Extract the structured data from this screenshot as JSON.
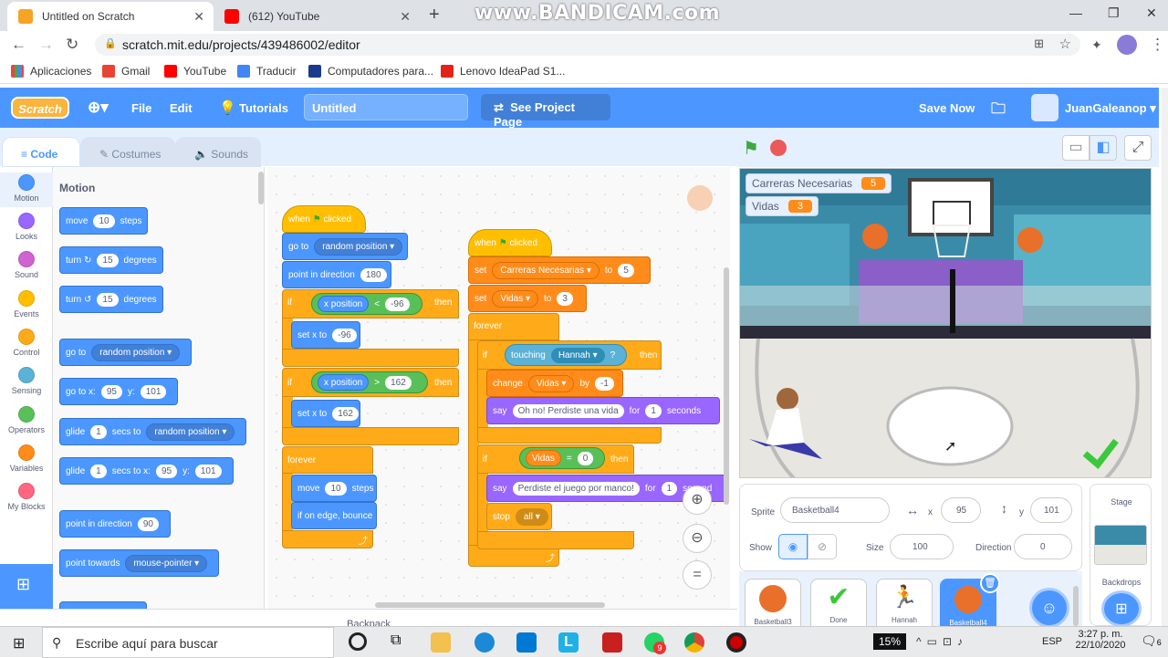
{
  "browser": {
    "tabs": [
      {
        "title": "Untitled on Scratch",
        "active": true
      },
      {
        "title": "(612) YouTube",
        "active": false
      }
    ],
    "watermark": "www.BANDICAM.com",
    "url": "scratch.mit.edu/projects/439486002/editor",
    "bookmarks": [
      "Aplicaciones",
      "Gmail",
      "YouTube",
      "Traducir",
      "Computadores para...",
      "Lenovo IdeaPad S1..."
    ]
  },
  "menu": {
    "logo": "Scratch",
    "file": "File",
    "edit": "Edit",
    "tutorials": "Tutorials",
    "project_title": "Untitled",
    "see_project": "See Project Page",
    "save": "Save Now",
    "user": "JuanGaleanop"
  },
  "editor_tabs": {
    "code": "Code",
    "costumes": "Costumes",
    "sounds": "Sounds"
  },
  "categories": [
    {
      "label": "Motion",
      "color": "#4c97ff"
    },
    {
      "label": "Looks",
      "color": "#9966ff"
    },
    {
      "label": "Sound",
      "color": "#cf63cf"
    },
    {
      "label": "Events",
      "color": "#ffbf00"
    },
    {
      "label": "Control",
      "color": "#ffab19"
    },
    {
      "label": "Sensing",
      "color": "#5cb1d6"
    },
    {
      "label": "Operators",
      "color": "#59c059"
    },
    {
      "label": "Variables",
      "color": "#ff8c1a"
    },
    {
      "label": "My Blocks",
      "color": "#ff6680"
    }
  ],
  "palette": {
    "heading": "Motion",
    "move": {
      "a": "move",
      "v": "10",
      "b": "steps"
    },
    "turn_r": {
      "a": "turn",
      "v": "15",
      "b": "degrees"
    },
    "turn_l": {
      "a": "turn",
      "v": "15",
      "b": "degrees"
    },
    "goto": {
      "a": "go to",
      "d": "random position"
    },
    "gotoxy": {
      "a": "go to x:",
      "x": "95",
      "y_label": "y:",
      "y": "101"
    },
    "glide": {
      "a": "glide",
      "v": "1",
      "b": "secs to",
      "d": "random position"
    },
    "glidexy": {
      "a": "glide",
      "v": "1",
      "b": "secs to x:",
      "x": "95",
      "y_label": "y:",
      "y": "101"
    },
    "point": {
      "a": "point in direction",
      "v": "90"
    },
    "towards": {
      "a": "point towards",
      "d": "mouse-pointer"
    }
  },
  "script1": {
    "hat": {
      "a": "when",
      "b": "clicked"
    },
    "goto": {
      "a": "go to",
      "d": "random position"
    },
    "point": {
      "a": "point in direction",
      "v": "180"
    },
    "if1": {
      "if": "if",
      "rep": "x position",
      "op": "<",
      "v": "-96",
      "then": "then"
    },
    "setx1": {
      "a": "set x to",
      "v": "-96"
    },
    "if2": {
      "if": "if",
      "rep": "x position",
      "op": ">",
      "v": "162",
      "then": "then"
    },
    "setx2": {
      "a": "set x to",
      "v": "162"
    },
    "forever": "forever",
    "move": {
      "a": "move",
      "v": "10",
      "b": "steps"
    },
    "bounce": "if on edge, bounce"
  },
  "script2": {
    "hat": {
      "a": "when",
      "b": "clicked"
    },
    "set1": {
      "a": "set",
      "d": "Carreras Necesarias",
      "b": "to",
      "v": "5"
    },
    "set2": {
      "a": "set",
      "d": "Vidas",
      "b": "to",
      "v": "3"
    },
    "forever": "forever",
    "if1": {
      "if": "if",
      "a": "touching",
      "d": "Hannah",
      "q": "?",
      "then": "then"
    },
    "change": {
      "a": "change",
      "d": "Vidas",
      "b": "by",
      "v": "-1"
    },
    "say1": {
      "a": "say",
      "msg": "Oh no! Perdiste una vida",
      "b": "for",
      "v": "1",
      "c": "seconds"
    },
    "if2": {
      "if": "if",
      "rep": "Vidas",
      "op": "=",
      "v": "0",
      "then": "then"
    },
    "say2": {
      "a": "say",
      "msg": "Perdiste el juego por manco!",
      "b": "for",
      "v": "1",
      "c": "second"
    },
    "stop": {
      "a": "stop",
      "d": "all"
    }
  },
  "backpack": "Backpack",
  "stage": {
    "monitors": [
      {
        "label": "Carreras Necesarias",
        "value": "5"
      },
      {
        "label": "Vidas",
        "value": "3"
      }
    ]
  },
  "sprite_info": {
    "sprite_label": "Sprite",
    "sprite_name": "Basketball4",
    "x_label": "x",
    "x": "95",
    "y_label": "y",
    "y": "101",
    "show_label": "Show",
    "size_label": "Size",
    "size": "100",
    "direction_label": "Direction",
    "direction": "0"
  },
  "sprites": [
    "Basketball3",
    "Done",
    "Hannah",
    "Basketball4"
  ],
  "stage_panel": {
    "title": "Stage",
    "backdrops": "Backdrops"
  },
  "taskbar": {
    "search": "Escribe aquí para buscar",
    "battery": "15%",
    "lang": "ESP",
    "time": "3:27 p. m.",
    "date": "22/10/2020",
    "notif": "6",
    "badge": "9"
  }
}
